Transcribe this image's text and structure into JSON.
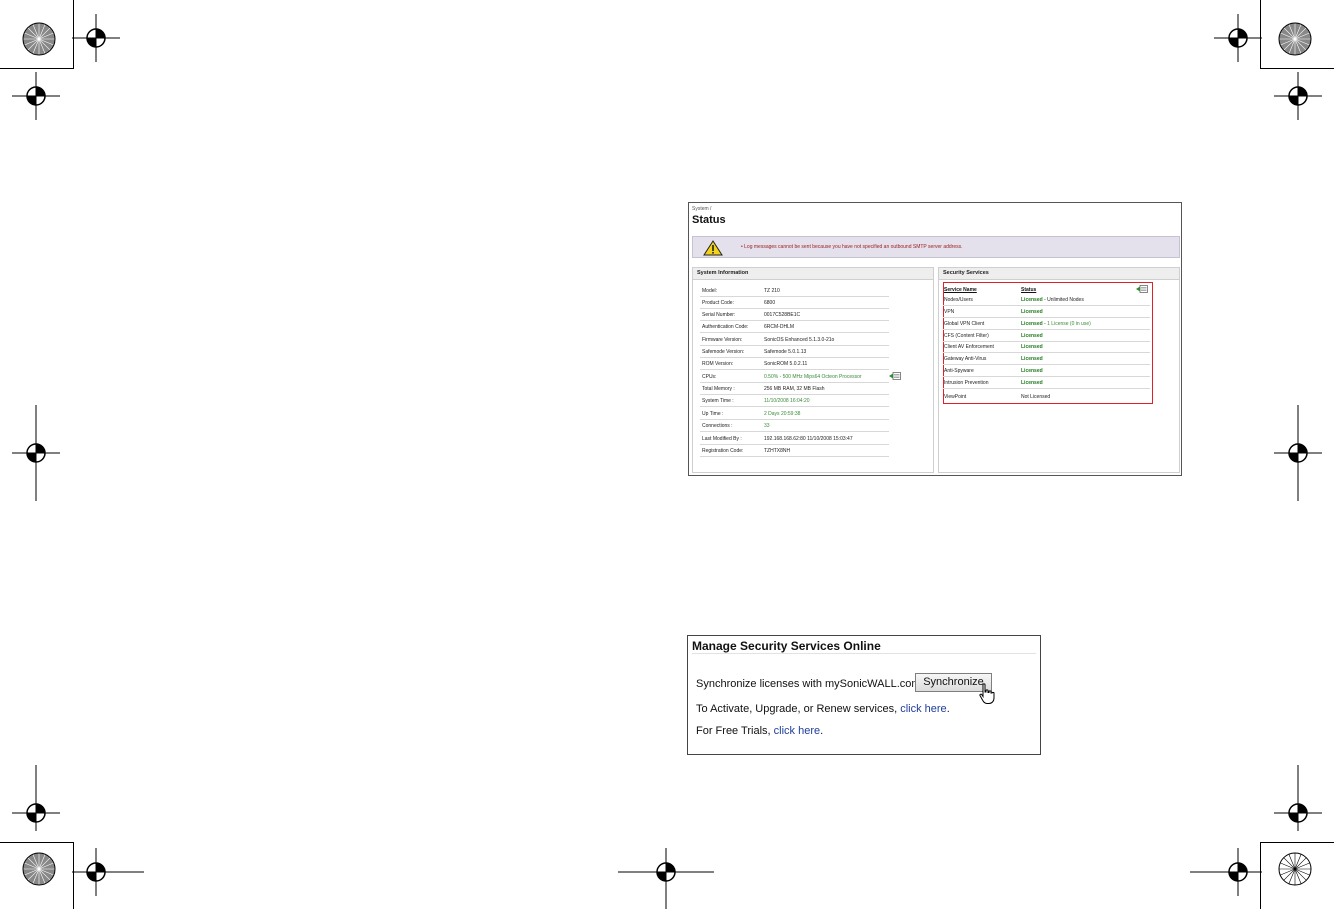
{
  "status_screen": {
    "breadcrumb": "System /",
    "title": "Status",
    "alert": "• Log messages cannot be sent because you have not specified an outbound SMTP server address.",
    "system_information": {
      "heading": "System Information",
      "rows": [
        {
          "label": "Model:",
          "value": "TZ 210"
        },
        {
          "label": "Product Code:",
          "value": "6800"
        },
        {
          "label": "Serial Number:",
          "value": "0017C528BE1C"
        },
        {
          "label": "Authentication Code:",
          "value": "6RCM-DHLM"
        },
        {
          "label": "Firmware Version:",
          "value": "SonicOS Enhanced 5.1.3.0-21o"
        },
        {
          "label": "Safemode Version:",
          "value": "Safemode 5.0.1.13"
        },
        {
          "label": "ROM Version:",
          "value": "SonicROM 5.0.2.11"
        },
        {
          "label": "CPUs:",
          "value": "0.50% - 500 MHz Mips64 Octeon Processor"
        },
        {
          "label": "Total Memory :",
          "value": "256 MB RAM, 32 MB Flash"
        },
        {
          "label": "System Time :",
          "value": "11/10/2008 16:04:20"
        },
        {
          "label": "Up Time :",
          "value": "2 Days 20:59:38"
        },
        {
          "label": "Connections :",
          "value": "33"
        },
        {
          "label": "Last Modified By :",
          "value": "192.168.168.62:80 11/10/2008 15:03:47"
        },
        {
          "label": "Registration Code:",
          "value": "TZHTX8NH"
        }
      ]
    },
    "security_services": {
      "heading": "Security Services",
      "col_service": "Service Name",
      "col_status": "Status",
      "rows": [
        {
          "name": "Nodes/Users",
          "status": "Licensed",
          "note": "Unlimited Nodes"
        },
        {
          "name": "VPN",
          "status": "Licensed",
          "note": ""
        },
        {
          "name": "Global VPN Client",
          "status": "Licensed",
          "note": "1 License (0 in use)"
        },
        {
          "name": "CFS (Content Filter)",
          "status": "Licensed",
          "note": ""
        },
        {
          "name": "Client AV Enforcement",
          "status": "Licensed",
          "note": ""
        },
        {
          "name": "Gateway Anti-Virus",
          "status": "Licensed",
          "note": ""
        },
        {
          "name": "Anti-Spyware",
          "status": "Licensed",
          "note": ""
        },
        {
          "name": "Intrusion Prevention",
          "status": "Licensed",
          "note": ""
        },
        {
          "name": "ViewPoint",
          "status": "Not Licensed",
          "note": ""
        }
      ]
    }
  },
  "manage": {
    "title": "Manage Security Services Online",
    "sync_label": "Synchronize licenses with mySonicWALL.com:",
    "sync_button": "Synchronize",
    "activate_text": "To Activate, Upgrade, or Renew services,",
    "activate_link": "click here",
    "trials_text": "For Free Trials,",
    "trials_link": "click here",
    "period": "."
  },
  "colors": {
    "licensed_green": "#1e7a1e",
    "value_green": "#3a8a3a",
    "highlight_red": "#e0202a",
    "alert_text": "#9a1b1b",
    "link_blue": "#1f3d9c"
  }
}
